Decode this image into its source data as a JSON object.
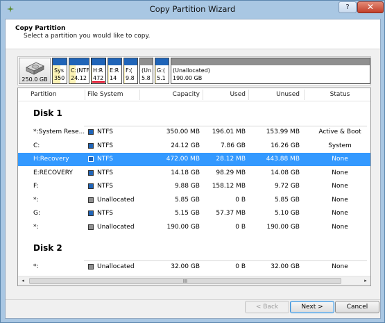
{
  "window": {
    "title": "Copy Partition Wizard",
    "help_label": "?",
    "close_label": "✕"
  },
  "header": {
    "title": "Copy Partition",
    "subtitle": "Select a partition you would like to copy."
  },
  "disk_map": {
    "disk_size": "250.0 GB",
    "partitions": [
      {
        "line1": "Sys",
        "line2": "350",
        "used_pct": 56,
        "selected": false,
        "unallocated": false
      },
      {
        "line1": "C:(NTF",
        "line2": "24.12",
        "used_pct": 33,
        "selected": false,
        "unallocated": false
      },
      {
        "line1": "H:R",
        "line2": "472",
        "used_pct": 6,
        "selected": true,
        "unallocated": false
      },
      {
        "line1": "E:R",
        "line2": "14",
        "used_pct": 1,
        "selected": false,
        "unallocated": false
      },
      {
        "line1": "F:(",
        "line2": "9.8",
        "used_pct": 2,
        "selected": false,
        "unallocated": false
      },
      {
        "line1": "(Un",
        "line2": "5.8",
        "used_pct": 0,
        "selected": false,
        "unallocated": true
      },
      {
        "line1": "G:(",
        "line2": "5.1",
        "used_pct": 1,
        "selected": false,
        "unallocated": false
      },
      {
        "line1": "(Unallocated)",
        "line2": "190.00 GB",
        "used_pct": 0,
        "selected": false,
        "unallocated": true
      }
    ]
  },
  "columns": [
    "Partition",
    "File System",
    "Capacity",
    "Used",
    "Unused",
    "Status"
  ],
  "colors": {
    "ntfs": "#1f64b8",
    "unallocated": "#8f8f8f",
    "selection": "#3399ff"
  },
  "disks": [
    {
      "name": "Disk 1",
      "rows": [
        {
          "partition": "*:System Rese...",
          "fs": "NTFS",
          "capacity": "350.00 MB",
          "used": "196.01 MB",
          "unused": "153.99 MB",
          "status": "Active & Boot",
          "selected": false
        },
        {
          "partition": "C:",
          "fs": "NTFS",
          "capacity": "24.12 GB",
          "used": "7.86 GB",
          "unused": "16.26 GB",
          "status": "System",
          "selected": false
        },
        {
          "partition": "H:Recovery",
          "fs": "NTFS",
          "capacity": "472.00 MB",
          "used": "28.12 MB",
          "unused": "443.88 MB",
          "status": "None",
          "selected": true
        },
        {
          "partition": "E:RECOVERY",
          "fs": "NTFS",
          "capacity": "14.18 GB",
          "used": "98.29 MB",
          "unused": "14.08 GB",
          "status": "None",
          "selected": false
        },
        {
          "partition": "F:",
          "fs": "NTFS",
          "capacity": "9.88 GB",
          "used": "158.12 MB",
          "unused": "9.72 GB",
          "status": "None",
          "selected": false
        },
        {
          "partition": "*:",
          "fs": "Unallocated",
          "capacity": "5.85 GB",
          "used": "0 B",
          "unused": "5.85 GB",
          "status": "None",
          "selected": false
        },
        {
          "partition": "G:",
          "fs": "NTFS",
          "capacity": "5.15 GB",
          "used": "57.37 MB",
          "unused": "5.10 GB",
          "status": "None",
          "selected": false
        },
        {
          "partition": "*:",
          "fs": "Unallocated",
          "capacity": "190.00 GB",
          "used": "0 B",
          "unused": "190.00 GB",
          "status": "None",
          "selected": false
        }
      ]
    },
    {
      "name": "Disk 2",
      "rows": [
        {
          "partition": "*:",
          "fs": "Unallocated",
          "capacity": "32.00 GB",
          "used": "0 B",
          "unused": "32.00 GB",
          "status": "None",
          "selected": false
        }
      ]
    }
  ],
  "scrollbar": {
    "left_arrow": "◂",
    "right_arrow": "▸",
    "grip": "III"
  },
  "buttons": {
    "back": "< Back",
    "next": "Next >",
    "cancel": "Cancel"
  }
}
